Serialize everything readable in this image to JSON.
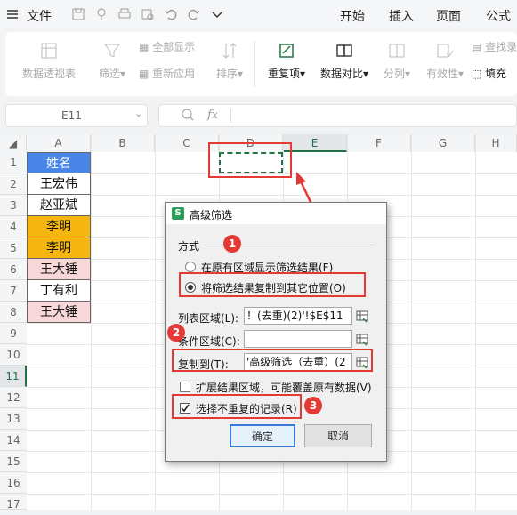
{
  "menubar": {
    "file_label": "文件",
    "tabs": [
      "开始",
      "插入",
      "页面",
      "公式"
    ]
  },
  "ribbon": {
    "pivot": "数据透视表",
    "filter": "筛选",
    "show_all": "全部显示",
    "reapply": "重新应用",
    "sort": "排序",
    "duplicates": "重复项",
    "compare": "数据对比",
    "split": "分列",
    "validity": "有效性",
    "find_entry": "查找录",
    "fill": "填充"
  },
  "formula_bar": {
    "cell_ref": "E11",
    "fx": "fx"
  },
  "sheet": {
    "columns": [
      "A",
      "B",
      "C",
      "D",
      "E",
      "F",
      "G",
      "H"
    ],
    "rows": [
      "1",
      "2",
      "3",
      "4",
      "5",
      "6",
      "7",
      "8",
      "9",
      "10",
      "11",
      "12",
      "13",
      "14",
      "15",
      "16",
      "17"
    ],
    "colA": [
      "姓名",
      "王宏伟",
      "赵亚斌",
      "李明",
      "李明",
      "王大锤",
      "丁有利",
      "王大锤"
    ]
  },
  "dialog": {
    "title": "高级筛选",
    "method_label": "方式",
    "option_inplace": "在原有区域显示筛选结果(F)",
    "option_copy": "将筛选结果复制到其它位置(O)",
    "list_range_label": "列表区域(L):",
    "list_range_value": "！(去重)(2)'!$E$11",
    "criteria_label": "条件区域(C):",
    "criteria_value": "",
    "copy_to_label": "复制到(T):",
    "copy_to_value": "'高级筛选（去重）(2",
    "expand_label": "扩展结果区域，可能覆盖原有数据(V)",
    "unique_label": "选择不重复的记录(R)",
    "ok": "确定",
    "cancel": "取消"
  },
  "annotations": [
    "1",
    "2",
    "3"
  ],
  "colors": {
    "accent_blue": "#4a86e8",
    "header_blue": "#4a86e8",
    "orange": "#f5b70f",
    "pink": "#f8d7da",
    "annotation_red": "#e53935",
    "selected_green": "#217346"
  }
}
